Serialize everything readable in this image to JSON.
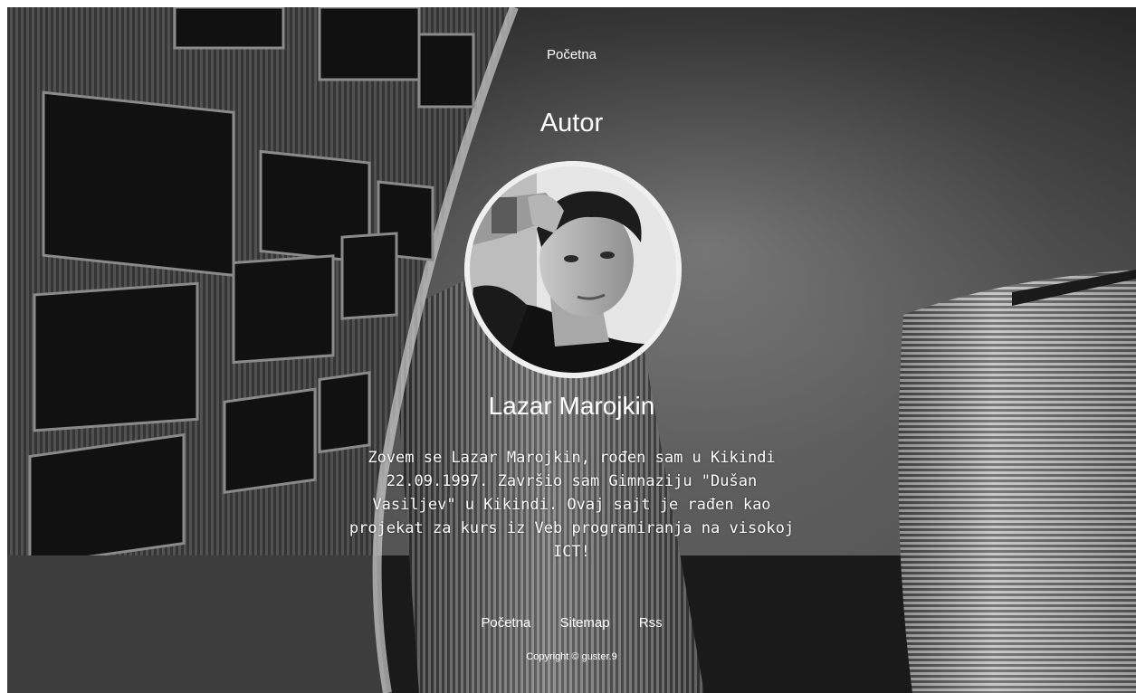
{
  "nav": {
    "home_label": "Početna"
  },
  "page": {
    "title": "Autor"
  },
  "author": {
    "name": "Lazar Marojkin",
    "bio": "Zovem se Lazar Marojkin, rođen sam u Kikindi 22.09.1997. Završio sam Gimnaziju \"Dušan Vasiljev\" u Kikindi. Ovaj sajt je rađen kao projekat za kurs iz Veb programiranja na visokoj ICT!"
  },
  "footer": {
    "links": {
      "home": "Početna",
      "sitemap": "Sitemap",
      "rss": "Rss"
    },
    "copyright": "Copyright © guster.9"
  },
  "icons": {
    "avatar": "author-photo"
  }
}
